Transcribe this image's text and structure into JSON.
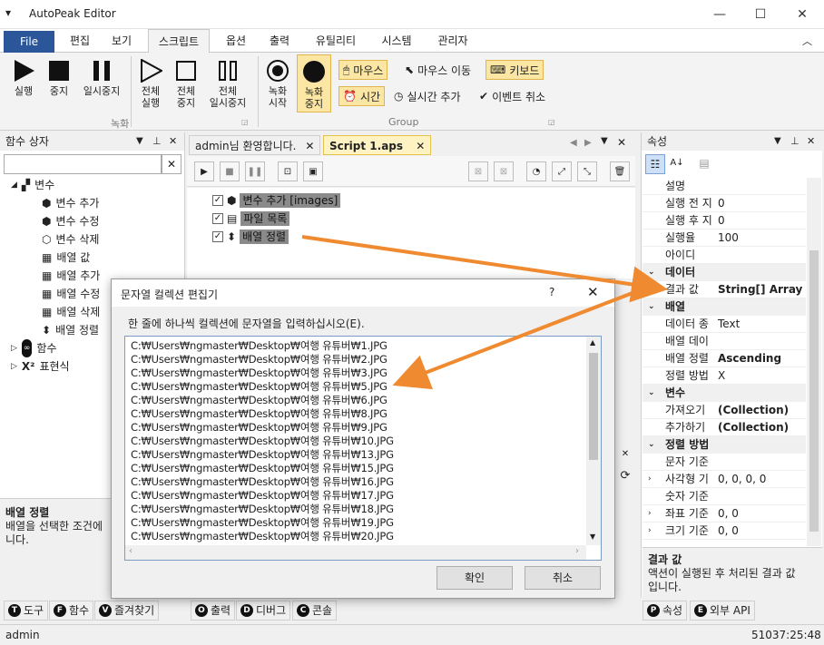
{
  "app": {
    "title": "AutoPeak Editor"
  },
  "menu": {
    "file": "File",
    "items": [
      "편집",
      "보기",
      "스크립트",
      "옵션",
      "출력",
      "유틸리티",
      "시스템",
      "관리자"
    ]
  },
  "ribbon": {
    "rec": {
      "run": "실행",
      "stop": "중지",
      "pause": "일시중지",
      "all_run": "전체\n실행",
      "all_stop": "전체\n중지",
      "all_pause": "전체\n일시중지",
      "rec_start": "녹화\n시작",
      "rec_stop": "녹화\n중지",
      "group_label": "녹화"
    },
    "group": {
      "mouse": "마우스",
      "mouse_move": "마우스 이동",
      "keyboard": "키보드",
      "time": "시간",
      "realtime_add": "실시간 추가",
      "event_cancel": "이벤트 취소",
      "group_label": "Group"
    }
  },
  "left_panel": {
    "title": "함수 상자",
    "tree": {
      "variables": "변수",
      "items": [
        "변수 추가",
        "변수 수정",
        "변수 삭제",
        "배열 값",
        "배열 추가",
        "배열 수정",
        "배열 삭제",
        "배열 정렬"
      ],
      "functions": "함수",
      "expression": "표현식"
    },
    "desc_title": "배열 정렬",
    "desc_text": "배열을 선택한 조건에\n니다."
  },
  "doc_tabs": [
    "admin님 환영합니다.",
    "Script 1.aps"
  ],
  "steps": [
    {
      "label": "변수 추가 [images]"
    },
    {
      "label": "파일 목록"
    },
    {
      "label": "배열 정렬"
    }
  ],
  "props": {
    "title": "속성",
    "rows_top": [
      {
        "name": "설명",
        "value": ""
      },
      {
        "name": "실행 전 지",
        "value": "0"
      },
      {
        "name": "실행 후 지",
        "value": "0"
      },
      {
        "name": "실행율",
        "value": "100"
      },
      {
        "name": "아이디",
        "value": ""
      }
    ],
    "cat_data": "데이터",
    "result": {
      "name": "결과 값",
      "value": "String[] Array"
    },
    "cat_array": "배열",
    "array_rows": [
      {
        "name": "데이터 종",
        "value": "Text"
      },
      {
        "name": "배열 데이",
        "value": ""
      },
      {
        "name": "배열 정렬",
        "value": "Ascending"
      },
      {
        "name": "정렬 방법",
        "value": "X"
      }
    ],
    "cat_var": "변수",
    "var_rows": [
      {
        "name": "가져오기",
        "value": "(Collection)"
      },
      {
        "name": "추가하기",
        "value": "(Collection)"
      }
    ],
    "cat_sort": "정렬 방법",
    "sort_rows": [
      {
        "name": "문자 기준",
        "value": ""
      },
      {
        "name": "사각형 기",
        "value": "0, 0, 0, 0"
      },
      {
        "name": "숫자 기준",
        "value": ""
      },
      {
        "name": "좌표 기준",
        "value": "0, 0"
      },
      {
        "name": "크기 기준",
        "value": "0, 0"
      }
    ],
    "desc_title": "결과 값",
    "desc_text": "액션이 실행된 후 처리된 결과 값\n입니다."
  },
  "dialog": {
    "title": "문자열 컬렉션 편집기",
    "help": "?",
    "instruction": "한 줄에 하나씩 컬렉션에 문자열을 입력하십시오(E).",
    "lines": [
      "C:₩Users₩ngmaster₩Desktop₩여행 유튜버₩1.JPG",
      "C:₩Users₩ngmaster₩Desktop₩여행 유튜버₩2.JPG",
      "C:₩Users₩ngmaster₩Desktop₩여행 유튜버₩3.JPG",
      "C:₩Users₩ngmaster₩Desktop₩여행 유튜버₩5.JPG",
      "C:₩Users₩ngmaster₩Desktop₩여행 유튜버₩6.JPG",
      "C:₩Users₩ngmaster₩Desktop₩여행 유튜버₩8.JPG",
      "C:₩Users₩ngmaster₩Desktop₩여행 유튜버₩9.JPG",
      "C:₩Users₩ngmaster₩Desktop₩여행 유튜버₩10.JPG",
      "C:₩Users₩ngmaster₩Desktop₩여행 유튜버₩13.JPG",
      "C:₩Users₩ngmaster₩Desktop₩여행 유튜버₩15.JPG",
      "C:₩Users₩ngmaster₩Desktop₩여행 유튜버₩16.JPG",
      "C:₩Users₩ngmaster₩Desktop₩여행 유튜버₩17.JPG",
      "C:₩Users₩ngmaster₩Desktop₩여행 유튜버₩18.JPG",
      "C:₩Users₩ngmaster₩Desktop₩여행 유튜버₩19.JPG",
      "C:₩Users₩ngmaster₩Desktop₩여행 유튜버₩20.JPG"
    ],
    "ok": "확인",
    "cancel": "취소"
  },
  "bottom_tabs_left": [
    "도구",
    "함수",
    "즐겨찾기"
  ],
  "bottom_tabs_mid": [
    "출력",
    "디버그",
    "콘솔"
  ],
  "bottom_tabs_right": [
    "속성",
    "외부 API"
  ],
  "status": {
    "user": "admin",
    "time": "51037:25:48"
  },
  "colors": {
    "accent": "#2b579a",
    "highlight": "#fbe7a3",
    "arrow": "#f08a30"
  }
}
